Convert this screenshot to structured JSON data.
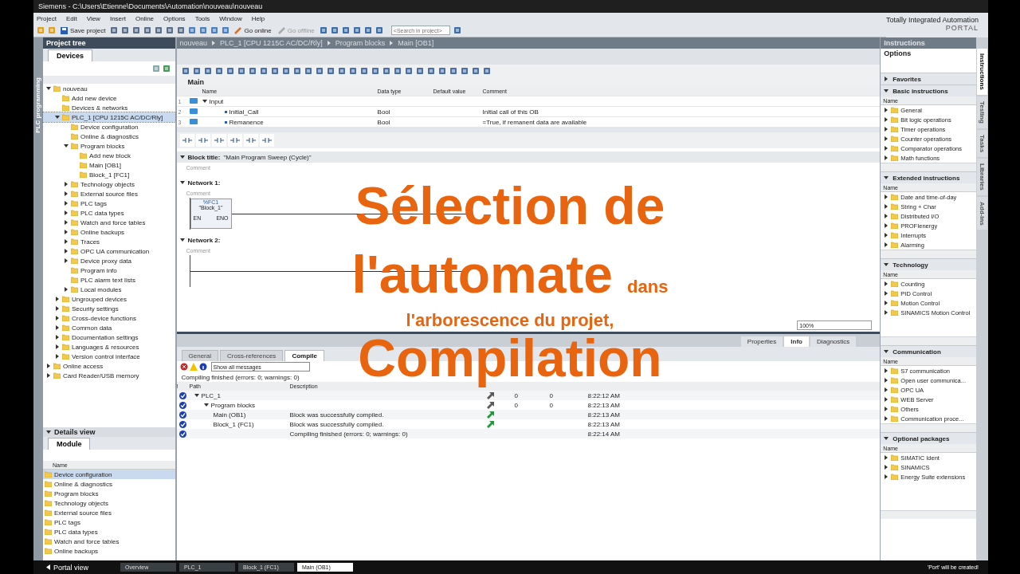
{
  "window": {
    "title": "Siemens - C:\\Users\\Etienne\\Documents\\Automation\\nouveau\\nouveau",
    "brand": "Totally Integrated Automation",
    "brand_sub": "PORTAL"
  },
  "menu": [
    "Project",
    "Edit",
    "View",
    "Insert",
    "Online",
    "Options",
    "Tools",
    "Window",
    "Help"
  ],
  "toolbar": {
    "save": "Save project",
    "go_online": "Go online",
    "go_offline": {
      "label": "Go offline",
      "disabled": true
    },
    "search": {
      "placeholder": "<Search in project>"
    }
  },
  "side_tab": "PLC programming",
  "project_tree": {
    "title": "Project tree",
    "tabs": [
      {
        "label": "Devices",
        "selected": true
      }
    ],
    "items": [
      {
        "label": "nouveau",
        "expanded": true,
        "selected": false,
        "children": [
          {
            "label": "Add new device",
            "selected": false
          },
          {
            "label": "Devices & networks",
            "selected": false
          },
          {
            "label": "PLC_1 [CPU 1215C AC/DC/Rly]",
            "expanded": true,
            "selected": true,
            "children": [
              {
                "label": "Device configuration",
                "selected": false
              },
              {
                "label": "Online & diagnostics",
                "selected": false
              },
              {
                "label": "Program blocks",
                "expanded": true,
                "selected": false,
                "children": [
                  {
                    "label": "Add new block",
                    "selected": false
                  },
                  {
                    "label": "Main [OB1]",
                    "selected": false
                  },
                  {
                    "label": "Block_1 [FC1]",
                    "selected": false
                  }
                ]
              },
              {
                "label": "Technology objects",
                "expanded": false,
                "selected": false
              },
              {
                "label": "External source files",
                "expanded": false,
                "selected": false
              },
              {
                "label": "PLC tags",
                "expanded": false,
                "selected": false
              },
              {
                "label": "PLC data types",
                "expanded": false,
                "selected": false
              },
              {
                "label": "Watch and force tables",
                "expanded": false,
                "selected": false
              },
              {
                "label": "Online backups",
                "expanded": false,
                "selected": false
              },
              {
                "label": "Traces",
                "expanded": false,
                "selected": false
              },
              {
                "label": "OPC UA communication",
                "expanded": false,
                "selected": false
              },
              {
                "label": "Device proxy data",
                "expanded": false,
                "selected": false
              },
              {
                "label": "Program info",
                "selected": false
              },
              {
                "label": "PLC alarm text lists",
                "selected": false
              },
              {
                "label": "Local modules",
                "expanded": false,
                "selected": false
              }
            ]
          },
          {
            "label": "Ungrouped devices",
            "expanded": false,
            "selected": false
          },
          {
            "label": "Security settings",
            "expanded": false,
            "selected": false
          },
          {
            "label": "Cross-device functions",
            "expanded": false,
            "selected": false
          },
          {
            "label": "Common data",
            "expanded": false,
            "selected": false
          },
          {
            "label": "Documentation settings",
            "expanded": false,
            "selected": false
          },
          {
            "label": "Languages & resources",
            "expanded": false,
            "selected": false
          },
          {
            "label": "Version control interface",
            "expanded": false,
            "selected": false
          }
        ]
      },
      {
        "label": "Online access",
        "expanded": false,
        "selected": false
      },
      {
        "label": "Card Reader/USB memory",
        "expanded": false,
        "selected": false
      }
    ]
  },
  "details_view": {
    "title": "Details view",
    "tab": "Module",
    "column": "Name",
    "items": [
      {
        "label": "Device configuration",
        "selected": true
      },
      {
        "label": "Online & diagnostics",
        "selected": false
      },
      {
        "label": "Program blocks",
        "selected": false
      },
      {
        "label": "Technology objects",
        "selected": false
      },
      {
        "label": "External source files",
        "selected": false
      },
      {
        "label": "PLC tags",
        "selected": false
      },
      {
        "label": "PLC data types",
        "selected": false
      },
      {
        "label": "Watch and force tables",
        "selected": false
      },
      {
        "label": "Online backups",
        "selected": false
      }
    ]
  },
  "editor": {
    "breadcrumb": [
      "nouveau",
      "PLC_1 [CPU 1215C AC/DC/Rly]",
      "Program blocks",
      "Main [OB1]"
    ],
    "interface": {
      "title": "Main",
      "columns": [
        "Name",
        "Data type",
        "Default value",
        "Comment"
      ],
      "rows": [
        {
          "num": "1",
          "kind": "section",
          "name": "Input",
          "expanded": true
        },
        {
          "num": "2",
          "kind": "tag",
          "name": "Initial_Call",
          "data_type": "Bool",
          "comment": "Initial call of this OB"
        },
        {
          "num": "3",
          "kind": "tag",
          "name": "Remanence",
          "data_type": "Bool",
          "comment": "=True, if remanent data are available"
        }
      ]
    },
    "block_title": {
      "label": "Block title:",
      "value": "\"Main Program Sweep (Cycle)\"",
      "comment": "Comment"
    },
    "networks": [
      {
        "title": "Network 1:",
        "comment": "Comment",
        "block": {
          "address": "%FC1",
          "name": "\"Block_1\"",
          "en": "EN",
          "eno": "ENO"
        }
      },
      {
        "title": "Network 2:",
        "comment": "Comment"
      }
    ],
    "zoom": "100%"
  },
  "inspector": {
    "tabs": [
      {
        "label": "Properties",
        "selected": false
      },
      {
        "label": "Info",
        "selected": true
      },
      {
        "label": "Diagnostics",
        "selected": false
      }
    ],
    "subtabs": [
      {
        "label": "General",
        "selected": false
      },
      {
        "label": "Cross-references",
        "selected": false
      },
      {
        "label": "Compile",
        "selected": true
      }
    ],
    "filter": "Show all messages",
    "summary": "Compiling finished (errors: 0; warnings: 0)",
    "columns": [
      "!",
      "Path",
      "Description"
    ],
    "rows": [
      {
        "path": "PLC_1",
        "expanded": true,
        "color": "#5a5a5a",
        "errors": "0",
        "warnings": "0",
        "time": "8:22:12 AM",
        "children": [
          {
            "path": "Program blocks",
            "expanded": true,
            "color": "#5a5a5a",
            "errors": "0",
            "warnings": "0",
            "time": "8:22:13 AM",
            "children": [
              {
                "path": "Main (OB1)",
                "description": "Block was successfully compiled.",
                "color": "#1f9a3a",
                "time": "8:22:13 AM"
              },
              {
                "path": "Block_1 (FC1)",
                "description": "Block was successfully compiled.",
                "color": "#1f9a3a",
                "time": "8:22:13 AM"
              }
            ]
          }
        ]
      },
      {
        "description": "Compiling finished (errors: 0; warnings: 0)",
        "time": "8:22:14 AM"
      }
    ]
  },
  "instructions": {
    "title": "Instructions",
    "options": "Options",
    "sections": [
      {
        "title": "Favorites",
        "expanded": false
      },
      {
        "title": "Basic instructions",
        "expanded": true,
        "column": "Name",
        "items": [
          "General",
          "Bit logic operations",
          "Timer operations",
          "Counter operations",
          "Comparator operations",
          "Math functions"
        ]
      },
      {
        "title": "Extended instructions",
        "expanded": true,
        "column": "Name",
        "items": [
          "Date and time-of-day",
          "String + Char",
          "Distributed I/O",
          "PROFIenergy",
          "Interrupts",
          "Alarming"
        ]
      },
      {
        "title": "Technology",
        "expanded": true,
        "column": "Name",
        "items": [
          "Counting",
          "PID Control",
          "Motion Control",
          "SINAMICS Motion Control"
        ]
      },
      {
        "title": "Communication",
        "expanded": true,
        "column": "Name",
        "items": [
          "S7 communication",
          "Open user communica...",
          "OPC UA",
          "WEB Server",
          "Others",
          "Communication proce..."
        ]
      },
      {
        "title": "Optional packages",
        "expanded": true,
        "column": "Name",
        "items": [
          "SIMATIC Ident",
          "SINAMICS",
          "Energy Suite extensions"
        ]
      }
    ]
  },
  "task_tabs": [
    {
      "label": "Instructions",
      "selected": true
    },
    {
      "label": "Testing",
      "selected": false
    },
    {
      "label": "Tasks",
      "selected": false
    },
    {
      "label": "Libraries",
      "selected": false
    },
    {
      "label": "Add-ins",
      "selected": false
    }
  ],
  "taskbar": {
    "portal_view": "Portal view",
    "tabs": [
      {
        "label": "Overview",
        "selected": false
      },
      {
        "label": "PLC_1",
        "selected": false
      },
      {
        "label": "Block_1 (FC1)",
        "selected": false
      },
      {
        "label": "Main (OB1)",
        "selected": true
      }
    ],
    "status": "'Port' will be created!"
  },
  "overlay": [
    [
      {
        "text": "Sélection de",
        "kind": "large"
      }
    ],
    [
      {
        "text": "l'automate",
        "kind": "large"
      },
      {
        "text": "dans",
        "kind": "small"
      }
    ],
    [
      {
        "text": "l'arborescence du projet,",
        "kind": "small"
      }
    ],
    [
      {
        "text": "Compilation",
        "kind": "large"
      }
    ]
  ]
}
